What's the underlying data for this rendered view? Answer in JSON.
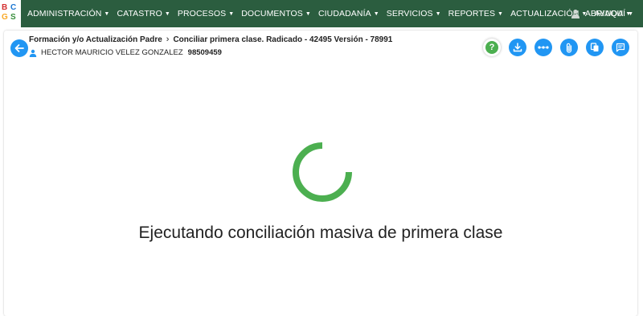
{
  "logo": {
    "letters": [
      "B",
      "C",
      "G",
      "S"
    ],
    "colors": [
      "#d32f2f",
      "#1976d2",
      "#f9a825",
      "#388e3c"
    ]
  },
  "navbar": {
    "bg_color": "#2b5d3f",
    "items": [
      {
        "label": "ADMINISTRACIÓN"
      },
      {
        "label": "CATASTRO"
      },
      {
        "label": "PROCESOS"
      },
      {
        "label": "DOCUMENTOS"
      },
      {
        "label": "CIUDADANÍA"
      },
      {
        "label": "SERVICIOS"
      },
      {
        "label": "REPORTES"
      },
      {
        "label": "ACTUALIZACIÓN"
      },
      {
        "label": "AYUDA"
      }
    ],
    "user": {
      "label": "ABRIAQUÍ",
      "icon": "user-icon"
    }
  },
  "header": {
    "breadcrumb": {
      "parent": "Formación y/o Actualización Padre",
      "current": "Conciliar primera clase. Radicado - 42495 Versión - 78991"
    },
    "person": {
      "name": "HECTOR MAURICIO VELEZ GONZALEZ",
      "id": "98509459"
    }
  },
  "actions": [
    {
      "name": "help-icon",
      "symbol": "?"
    },
    {
      "name": "download-icon"
    },
    {
      "name": "more-icon"
    },
    {
      "name": "attachment-icon"
    },
    {
      "name": "copy-icon"
    },
    {
      "name": "notes-icon"
    }
  ],
  "colors": {
    "accent": "#2196f3",
    "spinner": "#4caf50"
  },
  "loading": {
    "message": "Ejecutando conciliación masiva de primera clase"
  }
}
